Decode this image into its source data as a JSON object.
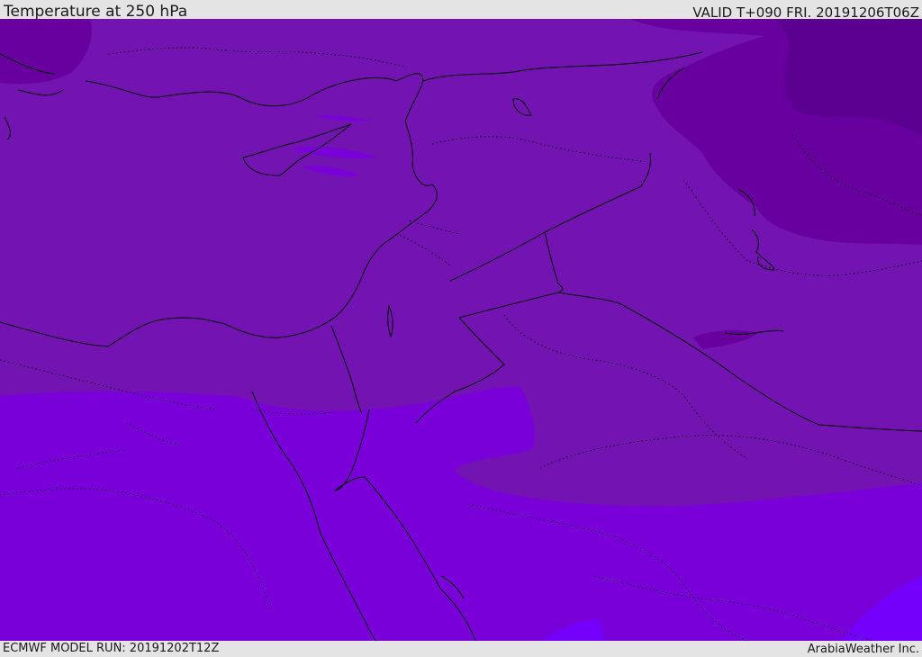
{
  "header": {
    "title": "Temperature at 250 hPa",
    "valid": "VALID T+090 FRI. 20191206T06Z"
  },
  "footer": {
    "model_run": "ECMWF MODEL RUN: 20191202T12Z",
    "credit": "ArabiaWeather Inc."
  },
  "map": {
    "variable": "Temperature",
    "level": "250 hPa",
    "colors": {
      "coldest": "#5b0090",
      "colder": "#67009f",
      "cold": "#7313b2",
      "mild": "#7a00d9",
      "warm": "#7400fb",
      "coastline": "#000000",
      "border": "#000000"
    }
  }
}
